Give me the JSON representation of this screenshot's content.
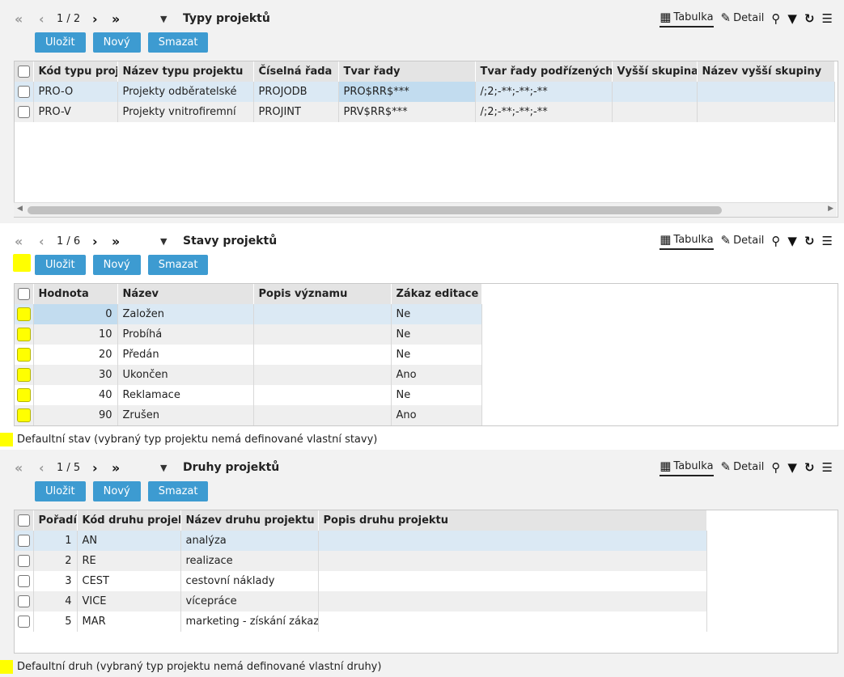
{
  "toolbar": {
    "tabulka": "Tabulka",
    "detail": "Detail",
    "save": "Uložit",
    "new": "Nový",
    "delete": "Smazat"
  },
  "sections": [
    {
      "page": "1 / 2",
      "title": "Typy projektů",
      "columns": [
        "Kód typu projektu",
        "Název typu projektu",
        "Číselná řada",
        "Tvar řady",
        "Tvar řady podřízených",
        "Vyšší skupina",
        "Název vyšší skupiny"
      ],
      "rows": [
        [
          "PRO-O",
          "Projekty odběratelské",
          "PROJODB",
          "PRO$RR$***",
          "/;2;-**;-**;-**",
          "",
          ""
        ],
        [
          "PRO-V",
          "Projekty vnitrofiremní",
          "PROJINT",
          "PRV$RR$***",
          "/;2;-**;-**;-**",
          "",
          ""
        ]
      ]
    },
    {
      "page": "1 / 6",
      "title": "Stavy projektů",
      "columns": [
        "Hodnota",
        "Název",
        "Popis významu",
        "Zákaz editace"
      ],
      "rows": [
        [
          "0",
          "Založen",
          "",
          "Ne"
        ],
        [
          "10",
          "Probíhá",
          "",
          "Ne"
        ],
        [
          "20",
          "Předán",
          "",
          "Ne"
        ],
        [
          "30",
          "Ukončen",
          "",
          "Ano"
        ],
        [
          "40",
          "Reklamace",
          "",
          "Ne"
        ],
        [
          "90",
          "Zrušen",
          "",
          "Ano"
        ]
      ],
      "legend": "Defaultní stav (vybraný typ projektu nemá definované vlastní stavy)"
    },
    {
      "page": "1 / 5",
      "title": "Druhy projektů",
      "columns": [
        "Pořadí",
        "Kód druhu projektu",
        "Název druhu projektu",
        "Popis druhu projektu"
      ],
      "rows": [
        [
          "1",
          "AN",
          "analýza",
          ""
        ],
        [
          "2",
          "RE",
          "realizace",
          ""
        ],
        [
          "3",
          "CEST",
          "cestovní náklady",
          ""
        ],
        [
          "4",
          "VICE",
          "vícepráce",
          ""
        ],
        [
          "5",
          "MAR",
          "marketing - získání zákaz...",
          ""
        ]
      ],
      "legend": "Defaultní druh (vybraný typ projektu nemá definované vlastní druhy)"
    }
  ],
  "colors": {
    "accent": "#3d9bd1",
    "highlight": "#ffff00",
    "selected_row": "#dbe9f4"
  },
  "icons": [
    "first-page-icon",
    "prev-page-icon",
    "next-page-icon",
    "last-page-icon",
    "dropdown-icon",
    "table-icon",
    "edit-icon",
    "search-icon",
    "filter-icon",
    "refresh-icon",
    "menu-icon"
  ]
}
